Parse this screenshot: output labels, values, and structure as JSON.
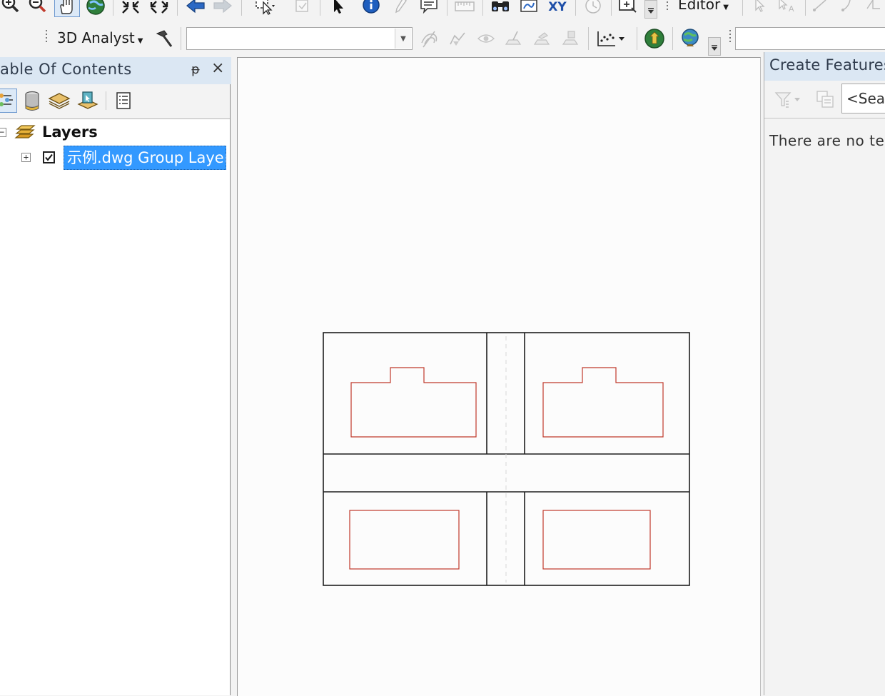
{
  "toolbar_top": {
    "editor_menu_label": "Editor",
    "xy_label": "XY",
    "icons": [
      "zoom-in-icon",
      "zoom-out-icon",
      "pan-icon",
      "full-extent-icon",
      "fixed-zoom-in-icon",
      "fixed-zoom-out-icon",
      "back-extent-icon",
      "forward-extent-icon",
      "select-features-icon",
      "clear-selection-icon",
      "select-elements-icon",
      "identify-icon",
      "hyperlink-icon",
      "html-popup-icon",
      "measure-icon",
      "find-icon",
      "find-route-icon",
      "go-to-xy-icon",
      "time-slider-icon",
      "create-viewer-icon",
      "toolbar-options-icon"
    ]
  },
  "toolbar_3d": {
    "label": "3D Analyst",
    "layer_combo_value": "",
    "icons": [
      "3d-analyst-tools-icon",
      "contour-icon",
      "steepest-path-icon",
      "line-of-sight-icon",
      "interpolate-line-icon",
      "interpolate-point-icon",
      "interpolate-polygon-icon",
      "profile-graph-icon",
      "arcscene-icon",
      "arcglobe-icon",
      "toolbar-options-icon"
    ]
  },
  "toc": {
    "title": "able Of Contents",
    "pin_glyph": "ᵽ",
    "close_glyph": "×",
    "tools": [
      "list-by-drawing-order-icon",
      "list-by-source-icon",
      "list-by-visibility-icon",
      "list-by-selection-icon",
      "options-icon"
    ],
    "root_label": "Layers",
    "root_expander": "−",
    "layer_expander": "+",
    "layers": [
      {
        "label": "示例.dwg Group Layer",
        "checked": true,
        "selected": true
      }
    ]
  },
  "map": {
    "colors": {
      "outline": "#1e1e1e",
      "building": "#c0392b"
    }
  },
  "create_features": {
    "title": "Create Features",
    "search_placeholder": "<Sear",
    "message": "There are no te",
    "icons": [
      "organize-templates-icon",
      "template-properties-icon"
    ]
  }
}
